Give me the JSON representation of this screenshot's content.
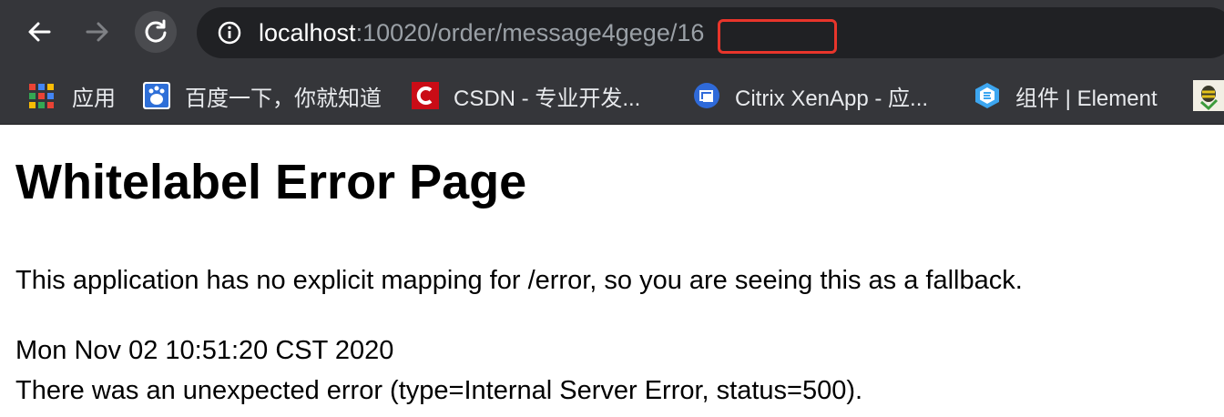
{
  "toolbar": {
    "url_host": "localhost",
    "url_path": ":10020/order/message4/gege/16",
    "url_path_before": ":10020/order/message4",
    "url_path_highlight": "gege/16"
  },
  "bookmarks": [
    {
      "label": "应用",
      "icon": "apps-grid-icon"
    },
    {
      "label": "百度一下，你就知道",
      "icon": "baidu-icon"
    },
    {
      "label": "CSDN - 专业开发...",
      "icon": "csdn-icon"
    },
    {
      "label": "Citrix XenApp - 应...",
      "icon": "citrix-icon"
    },
    {
      "label": "组件 | Element",
      "icon": "element-icon"
    }
  ],
  "page": {
    "title": "Whitelabel Error Page",
    "message": "This application has no explicit mapping for /error, so you are seeing this as a fallback.",
    "timestamp": "Mon Nov 02 10:51:20 CST 2020",
    "error": "There was an unexpected error (type=Internal Server Error, status=500)."
  },
  "colors": {
    "toolbar_bg": "#35363a",
    "omnibox_bg": "#202124",
    "highlight_border": "#e8352b"
  }
}
